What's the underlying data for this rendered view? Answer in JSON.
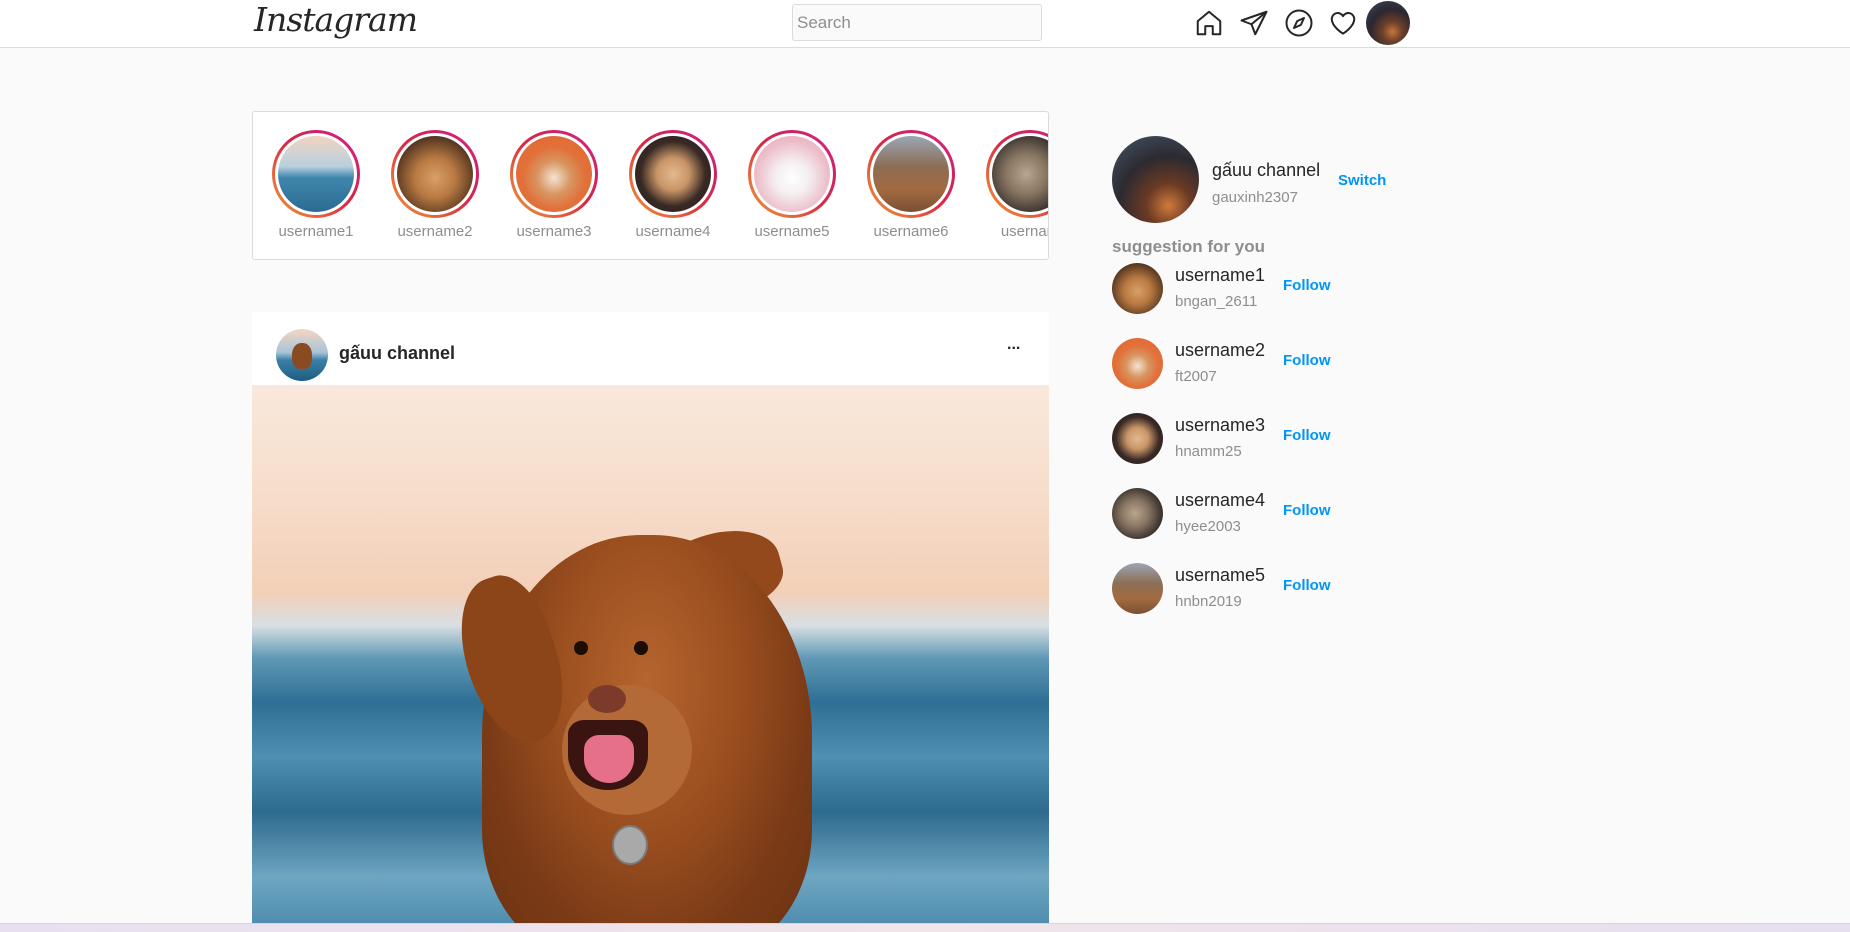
{
  "header": {
    "logo": "Instagram",
    "search_placeholder": "Search",
    "icons": [
      "home-icon",
      "direct-message-icon",
      "explore-icon",
      "activity-heart-icon",
      "profile-avatar"
    ]
  },
  "stories": [
    {
      "username": "username1"
    },
    {
      "username": "username2"
    },
    {
      "username": "username3"
    },
    {
      "username": "username4"
    },
    {
      "username": "username5"
    },
    {
      "username": "username6"
    },
    {
      "username": "usernam"
    }
  ],
  "post": {
    "username": "gấuu channel",
    "more": "..."
  },
  "sidebar": {
    "me": {
      "name": "gấuu channel",
      "handle": "gauxinh2307"
    },
    "switch_label": "Switch",
    "suggestion_title": "suggestion for you",
    "suggestions": [
      {
        "name": "username1",
        "handle": "bngan_2611",
        "follow": "Follow"
      },
      {
        "name": "username2",
        "handle": "ft2007",
        "follow": "Follow"
      },
      {
        "name": "username3",
        "handle": "hnamm25",
        "follow": "Follow"
      },
      {
        "name": "username4",
        "handle": "hyee2003",
        "follow": "Follow"
      },
      {
        "name": "username5",
        "handle": "hnbn2019",
        "follow": "Follow"
      }
    ]
  },
  "colors": {
    "accent": "#0095f6",
    "story_ring": "#e91e8c",
    "muted": "#8e8e8e"
  }
}
